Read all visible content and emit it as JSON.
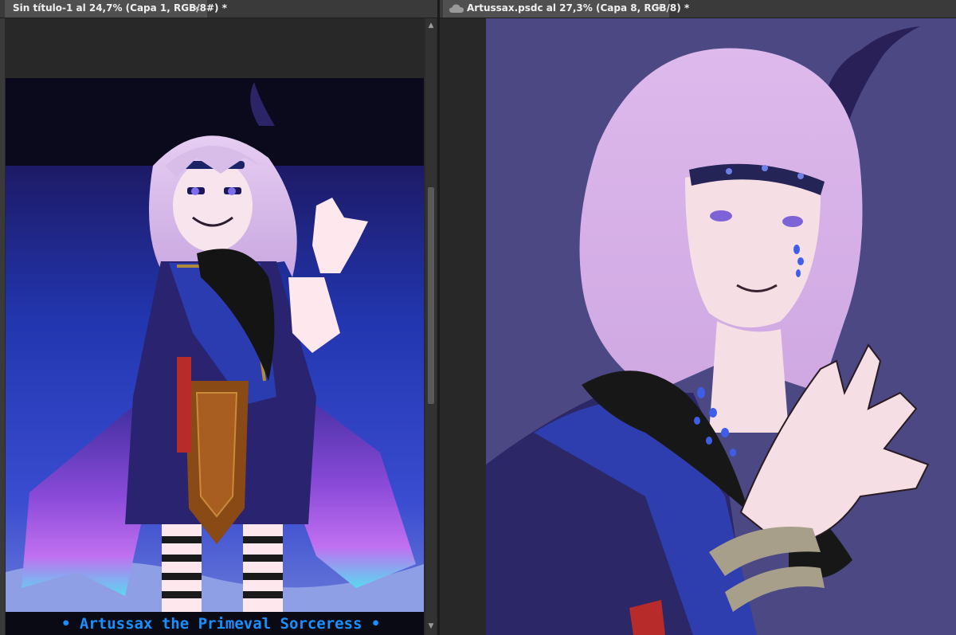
{
  "tabs": [
    {
      "label": "Sin título-1 al 24,7% (Capa 1, RGB/8#) *",
      "close": "×"
    },
    {
      "label": "Artussax.psdc al 27,3% (Capa 8, RGB/8) *",
      "close": "×",
      "icon": "cloud-icon"
    }
  ],
  "left_canvas": {
    "caption": "• Artussax  the Primeval Sorceress •",
    "scroll_up": "▲",
    "scroll_down": "▼"
  },
  "colors": {
    "workspace": "#282828",
    "tab_active": "#505050",
    "left_night_sky": "#1c2a9c",
    "right_background": "#4b4884",
    "hair": "#d7b8e6",
    "caption": "#1a8fff"
  }
}
